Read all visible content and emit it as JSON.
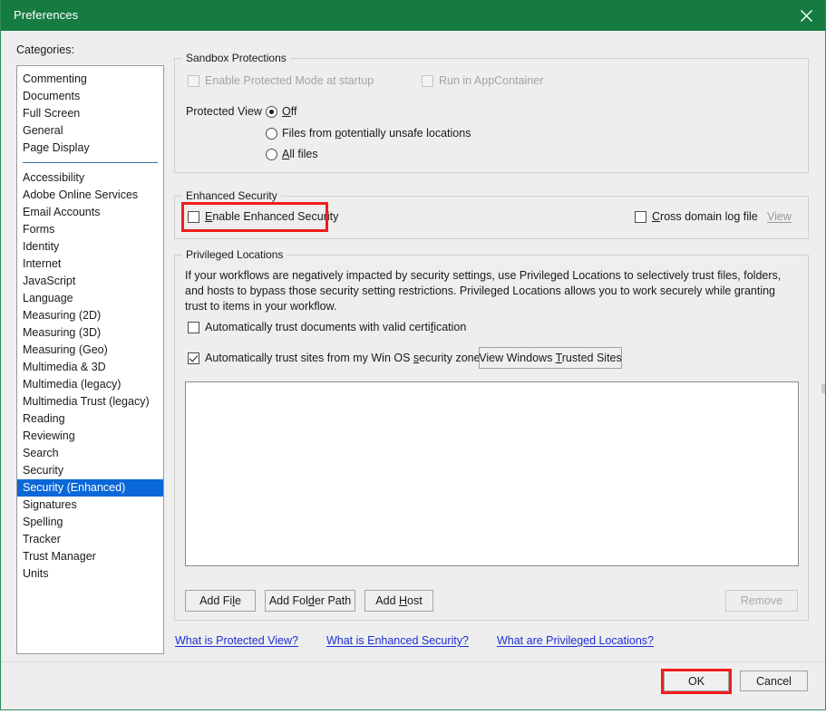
{
  "window": {
    "title": "Preferences",
    "close_icon": "close-icon",
    "titlebar_color": "#157b41",
    "accent_selection_color": "#0a68d8",
    "highlight_color": "#f51b1b"
  },
  "sidebar": {
    "label": "Categories:",
    "group_one": [
      "Commenting",
      "Documents",
      "Full Screen",
      "General",
      "Page Display"
    ],
    "group_two": [
      "Accessibility",
      "Adobe Online Services",
      "Email Accounts",
      "Forms",
      "Identity",
      "Internet",
      "JavaScript",
      "Language",
      "Measuring (2D)",
      "Measuring (3D)",
      "Measuring (Geo)",
      "Multimedia & 3D",
      "Multimedia (legacy)",
      "Multimedia Trust (legacy)",
      "Reading",
      "Reviewing",
      "Search",
      "Security",
      "Security (Enhanced)",
      "Signatures",
      "Spelling",
      "Tracker",
      "Trust Manager",
      "Units"
    ],
    "selected": "Security (Enhanced)"
  },
  "sandbox": {
    "group_title": "Sandbox Protections",
    "enable_protected_mode": {
      "label": "Enable Protected Mode at startup",
      "checked": false,
      "disabled": true
    },
    "run_in_appcontainer": {
      "label": "Run in AppContainer",
      "checked": false,
      "disabled": true
    },
    "protected_view_label": "Protected View",
    "protected_view_options": [
      {
        "label": "Off",
        "selected": true
      },
      {
        "label": "Files from potentially unsafe locations",
        "selected": false
      },
      {
        "label": "All files",
        "selected": false
      }
    ]
  },
  "enhanced_security": {
    "group_title": "Enhanced Security",
    "enable": {
      "label": "Enable Enhanced Security",
      "checked": false
    },
    "cross_domain_log": {
      "label": "Cross domain log file",
      "checked": false
    },
    "view_link": "View",
    "view_link_disabled": true
  },
  "privileged_locations": {
    "group_title": "Privileged Locations",
    "description": "If your workflows are negatively impacted by security settings, use Privileged Locations to selectively trust files, folders, and hosts to bypass those security setting restrictions. Privileged Locations allows you to work securely while granting trust to items in your workflow.",
    "trust_documents": {
      "label": "Automatically trust documents with valid certification",
      "checked": false
    },
    "trust_sites": {
      "label": "Automatically trust sites from my Win OS security zones",
      "checked": true
    },
    "view_trusted_sites_button": "View Windows Trusted Sites",
    "list_items": [],
    "add_file_button": "Add File",
    "add_folder_button": "Add Folder Path",
    "add_host_button": "Add Host",
    "remove_button": "Remove",
    "remove_disabled": true
  },
  "links": [
    "What is Protected View?",
    "What is Enhanced Security?",
    "What are Privileged Locations?"
  ],
  "footer": {
    "ok_label": "OK",
    "cancel_label": "Cancel"
  }
}
